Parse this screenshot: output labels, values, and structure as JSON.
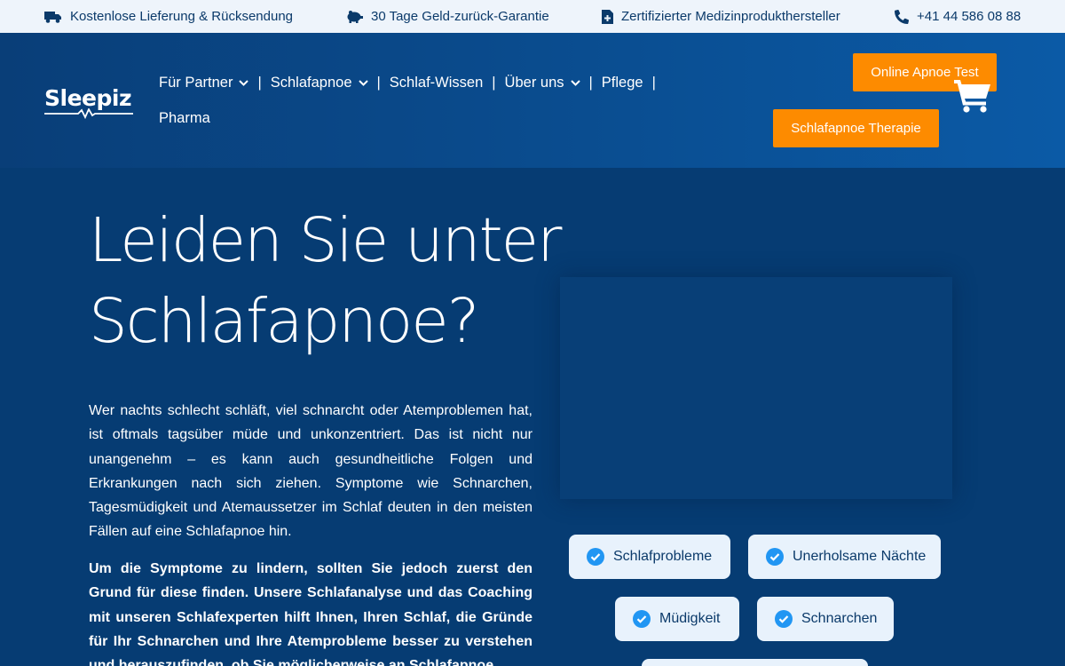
{
  "topbar": {
    "shipping": "Kostenlose Lieferung & Rücksendung",
    "guarantee": "30 Tage Geld-zurück-Garantie",
    "certified": "Zertifizierter Medizinprodukthersteller",
    "phone": "+41 44 586 08 88"
  },
  "header": {
    "logo": "Sleepiz",
    "nav": {
      "partner": "Für Partner",
      "apnea": "Schlafapnoe",
      "knowledge": "Schlaf-Wissen",
      "about": "Über uns",
      "care": "Pflege",
      "pharma": "Pharma",
      "separator": "|"
    },
    "cta_test": "Online Apnoe Test",
    "cta_therapy": "Schlafapnoe Therapie"
  },
  "hero": {
    "title_line1": "Leiden Sie unter",
    "title_line2": "Schlafapnoe?",
    "paragraph1": "Wer nachts schlecht schläft, viel schnarcht oder Atemproblemen hat, ist oftmals tagsüber müde und unkonzentriert. Das ist nicht nur unangenehm – es kann auch gesundheitliche Folgen und Erkrankungen nach sich ziehen. Symptome wie Schnarchen, Tagesmüdigkeit und Atemaussetzer im Schlaf deuten in den meisten Fällen auf eine Schlafapnoe hin.",
    "paragraph2": "Um die Symptome zu lindern, sollten Sie jedoch zuerst den Grund für diese finden. Unsere Schlafanalyse und das Coaching mit unseren Schlafexperten hilft Ihnen, Ihren Schlaf, die Gründe für Ihr Schnarchen und Ihre Atemprobleme besser zu verstehen und herauszufinden, ob Sie möglicherweise an Schlafapnoe"
  },
  "symptoms": [
    "Schlafprobleme",
    "Unerholsame Nächte",
    "Müdigkeit",
    "Schnarchen"
  ],
  "colors": {
    "accent": "#fd8b00",
    "background": "#063c73",
    "check": "#2196f3"
  }
}
